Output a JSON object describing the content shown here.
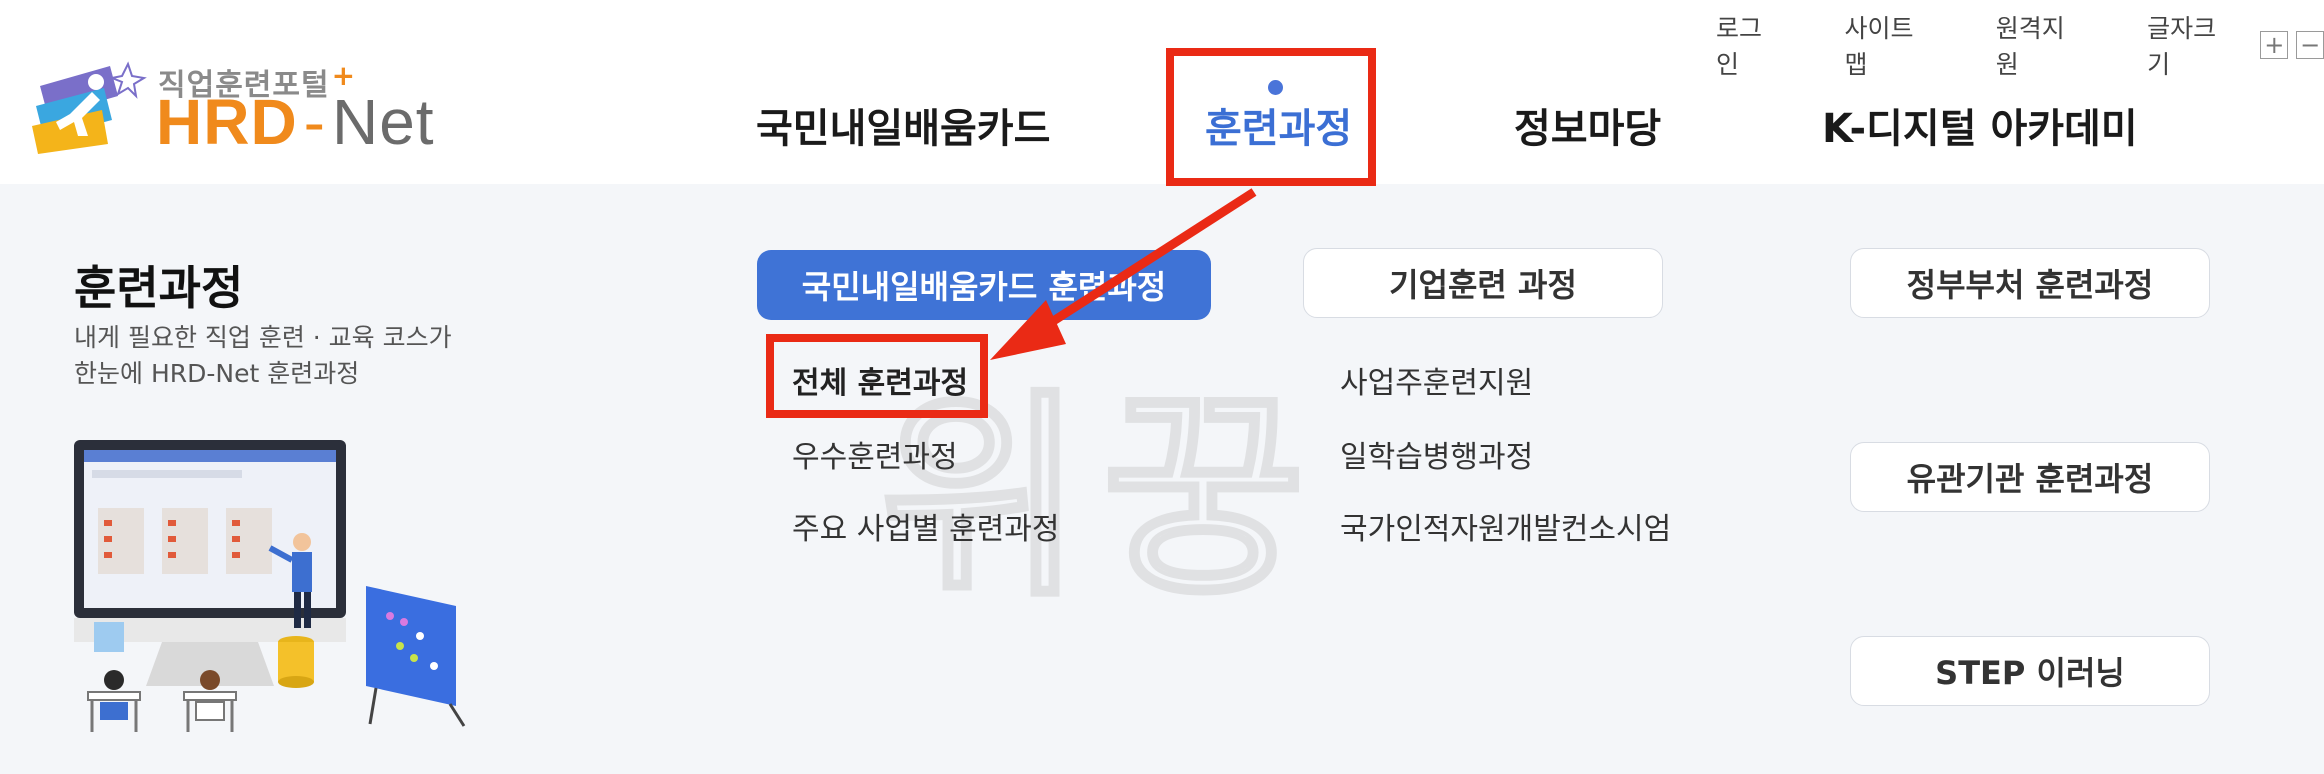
{
  "logo": {
    "subtitle": "직업훈련포털",
    "plus": "+",
    "hrd": "HRD",
    "dash": "-",
    "net": "Net"
  },
  "utility": {
    "login": "로그인",
    "sitemap": "사이트맵",
    "remote": "원격지원",
    "font_size": "글자크기",
    "increase": "+",
    "decrease": "−"
  },
  "gnb": {
    "items": [
      "국민내일배움카드",
      "훈련과정",
      "정보마당",
      "K-디지털 아카데미"
    ],
    "active_index": 1
  },
  "panel": {
    "title": "훈련과정",
    "desc_line1": "내게 필요한 직업 훈련 · 교육 코스가",
    "desc_line2": "한눈에 HRD-Net 훈련과정",
    "watermark": "위꿍"
  },
  "categories": {
    "card_course": "국민내일배움카드 훈련과정",
    "company_course": "기업훈련 과정",
    "gov_course": "정부부처 훈련과정",
    "related_course": "유관기관 훈련과정",
    "step": "STEP 이러닝"
  },
  "card_links": [
    "전체 훈련과정",
    "우수훈련과정",
    "주요 사업별 훈련과정"
  ],
  "company_links": [
    "사업주훈련지원",
    "일학습병행과정",
    "국가인적자원개발컨소시엄"
  ],
  "colors": {
    "accent_blue": "#3f73d6",
    "orange": "#f08a1c",
    "highlight_red": "#ea2a15"
  }
}
